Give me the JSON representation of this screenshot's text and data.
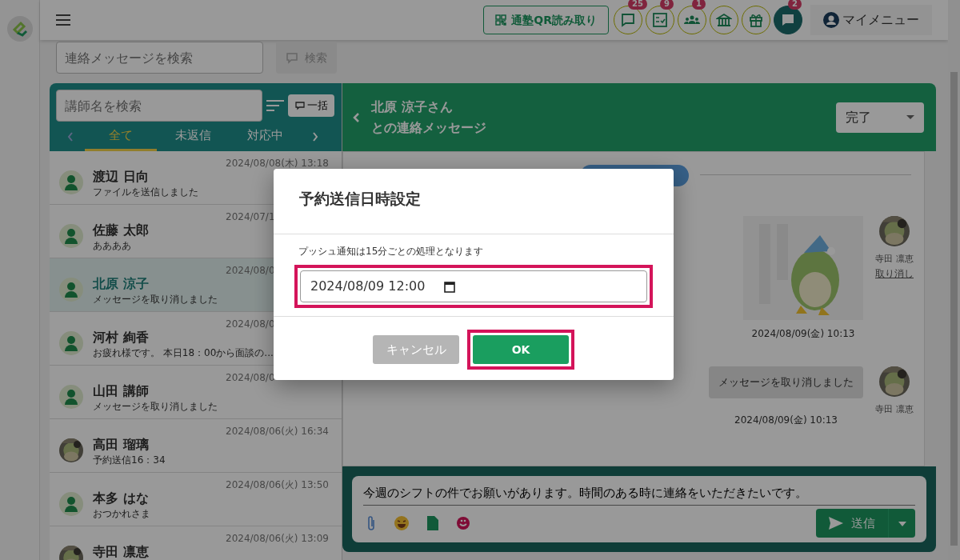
{
  "topbar": {
    "qr_button": "通塾QR読み取り",
    "icons": [
      {
        "kind": "chat",
        "badge": "25",
        "active": false
      },
      {
        "kind": "checklist",
        "badge": "9",
        "active": false
      },
      {
        "kind": "group",
        "badge": "1",
        "active": false
      },
      {
        "kind": "school",
        "active": false
      },
      {
        "kind": "gift",
        "active": false
      },
      {
        "kind": "chat",
        "badge": "2",
        "active": true
      }
    ],
    "menu": "マイメニュー"
  },
  "search": {
    "placeholder": "連絡メッセージを検索",
    "button": "検索"
  },
  "contacts": {
    "search_placeholder": "講師名を検索",
    "bulk_button": "一括",
    "tabs": [
      {
        "label": "全て",
        "selected": true
      },
      {
        "label": "未返信",
        "selected": false
      },
      {
        "label": "対応中",
        "selected": false
      }
    ],
    "items": [
      {
        "name": "渡辺 日向",
        "preview": "ファイルを送信しました",
        "time": "2024/08/08(木) 13:18",
        "kind": "person",
        "selected": false
      },
      {
        "name": "佐藤 太郎",
        "preview": "ああああ",
        "time": "2024/07/1",
        "kind": "person",
        "selected": false
      },
      {
        "name": "北原 涼子",
        "preview": "メッセージを取り消しました",
        "time": "2024/08/0",
        "kind": "person",
        "selected": true
      },
      {
        "name": "河村 絢香",
        "preview": "お疲れ様です。 本日18：00から面談の...",
        "time": "2024/08/0",
        "kind": "person",
        "selected": false
      },
      {
        "name": "山田 講師",
        "preview": "メッセージを取り消しました",
        "time": "2024/08/0",
        "kind": "person",
        "selected": false
      },
      {
        "name": "高田 瑠璃",
        "preview": "予約送信16：34",
        "time": "2024/08/06(火) 16:34",
        "kind": "picture",
        "selected": false
      },
      {
        "name": "本多 はな",
        "preview": "おつかれさま",
        "time": "2024/08/06(火) 13:50",
        "kind": "person",
        "selected": false
      },
      {
        "name": "寺田 凛恵",
        "time": "2024/08/06(火) 13:09",
        "kind": "picture",
        "selected": false
      }
    ]
  },
  "conversation": {
    "title": "北原 涼子さん",
    "subtitle": "との連絡メッセージ",
    "status": "完了",
    "messages": [
      {
        "kind": "sticker",
        "sender": "寺田 凛恵",
        "action": "取り消し",
        "time": "2024/08/09(金) 10:13"
      },
      {
        "kind": "text",
        "text": "メッセージを取り消しました",
        "sender": "寺田 凛恵",
        "time": "2024/08/09(金) 10:13"
      }
    ]
  },
  "composer": {
    "value": "今週のシフトの件でお願いがあります。時間のある時に連絡をいただきたいです。",
    "send": "送信"
  },
  "dialog": {
    "title": "予約送信日時設定",
    "note": "プッシュ通知は15分ごとの処理となります",
    "value": "2024/08/09 12:00",
    "field_highlighted": true,
    "cancel": "キャンセル",
    "ok": "OK",
    "ok_highlighted": true
  }
}
